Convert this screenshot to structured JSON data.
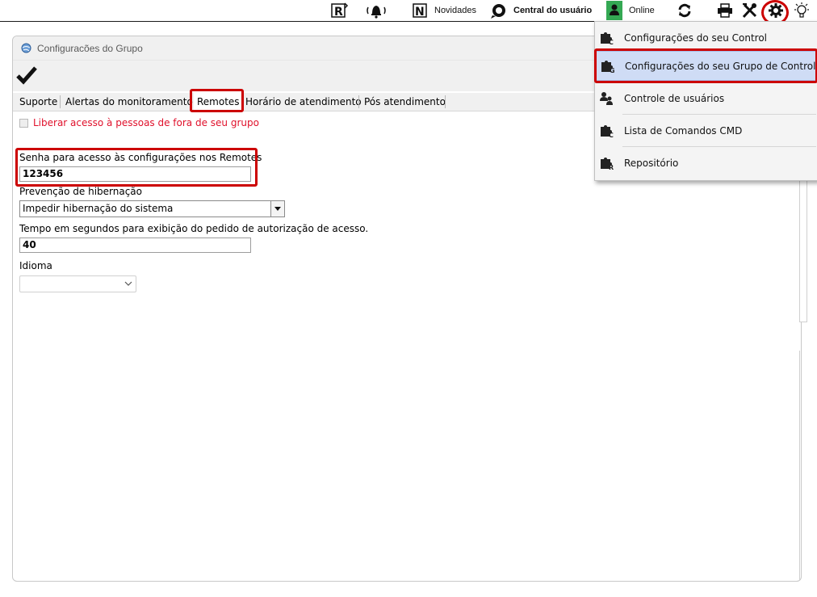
{
  "topbar": {
    "items": [
      {
        "name": "remote-r-icon"
      },
      {
        "name": "alarm-bell-icon"
      },
      {
        "name": "news-n-icon",
        "label": "Novidades"
      },
      {
        "name": "user-center-icon",
        "label": "Central do usuário"
      },
      {
        "name": "user-online-icon",
        "label": "Online"
      },
      {
        "name": "refresh-icon"
      },
      {
        "name": "printer-icon"
      },
      {
        "name": "tools-icon"
      },
      {
        "name": "settings-gear-icon"
      },
      {
        "name": "lightbulb-icon"
      }
    ],
    "online_color": "#34a853"
  },
  "window": {
    "title": "Configuracões do Grupo",
    "tabs": [
      {
        "label": "Suporte"
      },
      {
        "label": "Alertas do monitoramento"
      },
      {
        "label": "Remotes",
        "active": true
      },
      {
        "label": "Horário de atendimento"
      },
      {
        "label": "Pós atendimento"
      }
    ],
    "external_access_checkbox": {
      "label": "Liberar acesso à pessoas de fora de seu grupo",
      "checked": false
    },
    "password": {
      "label": "Senha para acesso às configurações nos Remotes",
      "value": "123456"
    },
    "hibernation": {
      "label": "Prevenção de hibernação",
      "value": "Impedir hibernação do sistema"
    },
    "timeout": {
      "label": "Tempo em segundos para exibição do pedido de autorização de acesso.",
      "value": "40"
    },
    "language": {
      "label": "Idioma",
      "value": ""
    }
  },
  "menu": {
    "items": [
      {
        "icon": "control-puzzle-icon",
        "label": "Configurações do seu Control"
      },
      {
        "icon": "group-puzzle-icon",
        "label": "Configurações do seu Grupo de Controls",
        "highlighted": true
      },
      {
        "icon": "users-icon",
        "label": "Controle de usuários"
      },
      {
        "icon": "cmd-puzzle-icon",
        "label": "Lista de Comandos CMD"
      },
      {
        "icon": "repository-puzzle-icon",
        "label": "Repositório"
      }
    ]
  },
  "colors": {
    "highlight_red": "#cc0000",
    "warning_text": "#e0102b",
    "menu_highlight": "#cfdcf5"
  }
}
